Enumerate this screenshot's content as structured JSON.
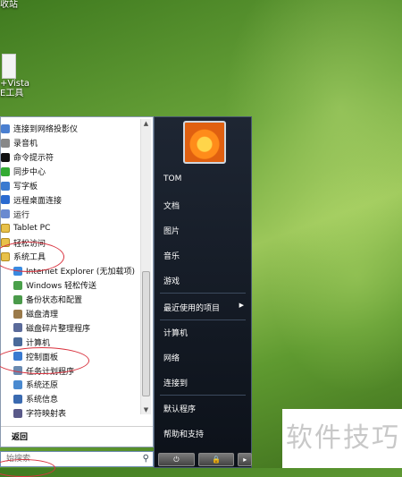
{
  "desktop": {
    "icon1_label": "收站",
    "icon2_label_line1": "+Vista",
    "icon2_label_line2": "E工具"
  },
  "programs": [
    {
      "label": "连接到网络投影仪",
      "color": "#4a7fd0",
      "sub": false,
      "folder": false
    },
    {
      "label": "录音机",
      "color": "#888888",
      "sub": false,
      "folder": false
    },
    {
      "label": "命令提示符",
      "color": "#111111",
      "sub": false,
      "folder": false
    },
    {
      "label": "同步中心",
      "color": "#33aa33",
      "sub": false,
      "folder": false
    },
    {
      "label": "写字板",
      "color": "#3a7ad0",
      "sub": false,
      "folder": false
    },
    {
      "label": "远程桌面连接",
      "color": "#2a6ad0",
      "sub": false,
      "folder": false
    },
    {
      "label": "运行",
      "color": "#6a8ad0",
      "sub": false,
      "folder": false
    },
    {
      "label": "Tablet PC",
      "color": "#e8c14a",
      "sub": false,
      "folder": true
    },
    {
      "label": "轻松访问",
      "color": "#e8c14a",
      "sub": false,
      "folder": true
    },
    {
      "label": "系统工具",
      "color": "#e8c14a",
      "sub": false,
      "folder": true
    },
    {
      "label": "Internet Explorer (无加载项)",
      "color": "#3a8ae0",
      "sub": true,
      "folder": false
    },
    {
      "label": "Windows 轻松传送",
      "color": "#4aa04a",
      "sub": true,
      "folder": false
    },
    {
      "label": "备份状态和配置",
      "color": "#4a9a4a",
      "sub": true,
      "folder": false
    },
    {
      "label": "磁盘清理",
      "color": "#9a7a4a",
      "sub": true,
      "folder": false
    },
    {
      "label": "磁盘碎片整理程序",
      "color": "#5a6a9a",
      "sub": true,
      "folder": false
    },
    {
      "label": "计算机",
      "color": "#4a6a9a",
      "sub": true,
      "folder": false
    },
    {
      "label": "控制面板",
      "color": "#3a7ad0",
      "sub": true,
      "folder": false
    },
    {
      "label": "任务计划程序",
      "color": "#6a8ab0",
      "sub": true,
      "folder": false
    },
    {
      "label": "系统还原",
      "color": "#4a8ad0",
      "sub": true,
      "folder": false
    },
    {
      "label": "系统信息",
      "color": "#3a6ab0",
      "sub": true,
      "folder": false
    },
    {
      "label": "字符映射表",
      "color": "#5a5a8a",
      "sub": true,
      "folder": false
    }
  ],
  "back_label": "返回",
  "search": {
    "placeholder": "始搜索"
  },
  "right_pane": {
    "user": "TOM",
    "documents": "文档",
    "pictures": "图片",
    "music": "音乐",
    "games": "游戏",
    "recent": "最近使用的项目",
    "computer": "计算机",
    "network": "网络",
    "connect": "连接到",
    "defaults": "默认程序",
    "help": "帮助和支持"
  },
  "power": {
    "power_glyph": "⏻",
    "lock_glyph": "🔒",
    "more_glyph": "▸"
  },
  "watermark": "软件技巧",
  "colors": {
    "annotation": "#d9333f",
    "menu_dark": "#0c1119",
    "accent": "#6d8bb0"
  }
}
